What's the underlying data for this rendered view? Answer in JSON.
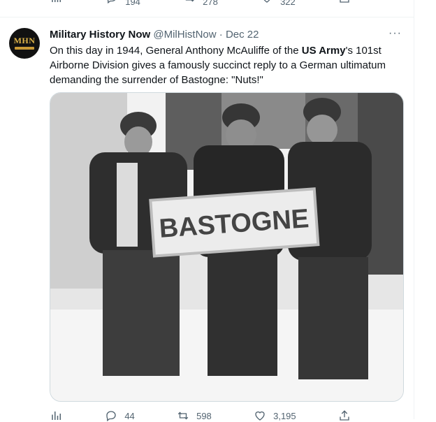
{
  "previous_tweet": {
    "analytics_icon": "analytics-icon",
    "replies": "194",
    "retweets": "278",
    "likes": "322",
    "share_icon": "share-icon"
  },
  "tweet": {
    "avatar_text": "MHN",
    "display_name": "Military History Now",
    "handle": "@MilHistNow",
    "separator": "·",
    "date": "Dec 22",
    "more": "···",
    "text_parts": {
      "p1": "On this day in 1944, General Anthony McAuliffe of the ",
      "bold": "US Army",
      "p2": "'s 101st Airborne Division gives a famously succinct reply to a German ultimatum demanding the surrender of Bastogne: \"Nuts!\""
    },
    "image_sign_text": "BASTOGNE",
    "actions": {
      "replies": "44",
      "retweets": "598",
      "likes": "3,195"
    }
  },
  "colors": {
    "text": "#0f1419",
    "secondary": "#536471",
    "border": "#cfd9de"
  }
}
